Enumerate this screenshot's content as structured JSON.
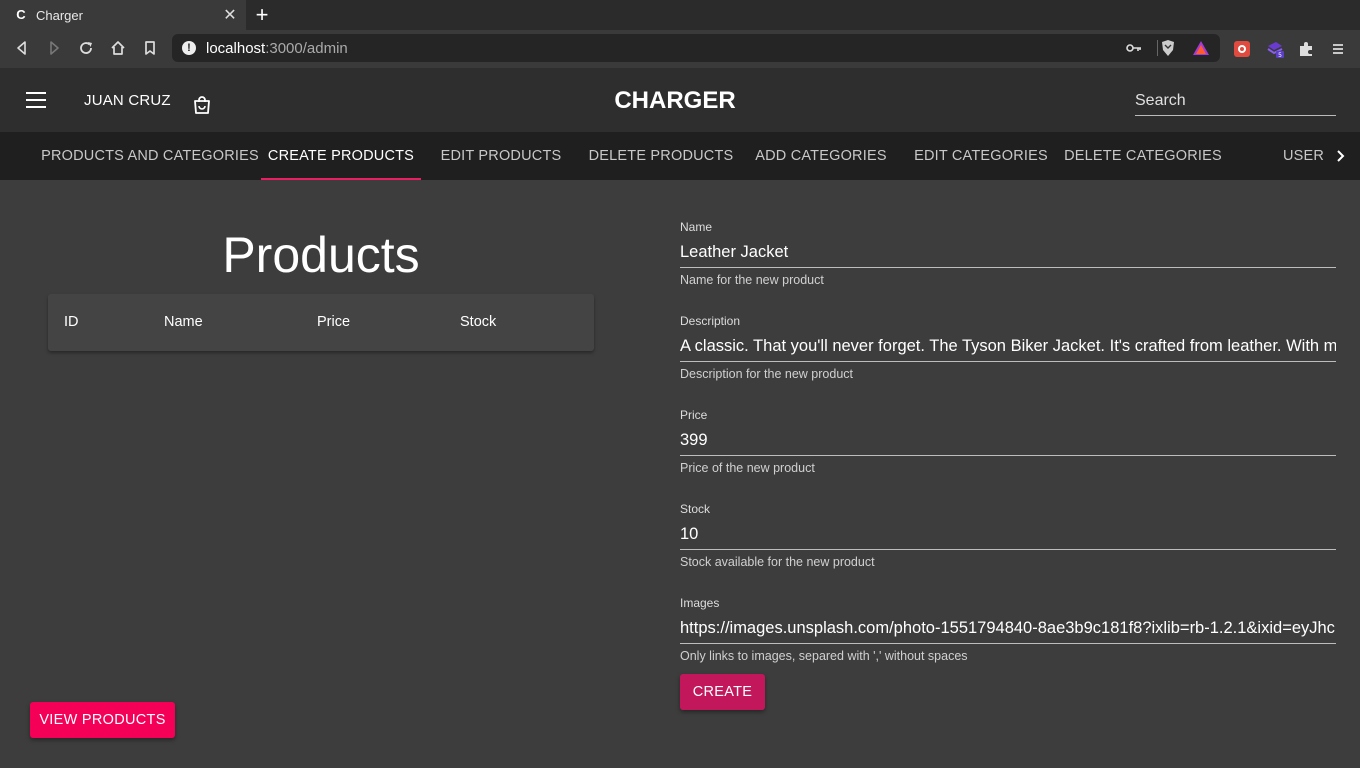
{
  "browser": {
    "tab_favicon": "C",
    "tab_title": "Charger",
    "url_host": "localhost",
    "url_path": ":3000/admin"
  },
  "header": {
    "user_name": "JUAN CRUZ",
    "brand": "CHARGER",
    "search_placeholder": "Search"
  },
  "nav": {
    "tabs": [
      {
        "label": "PRODUCTS AND CATEGORIES"
      },
      {
        "label": "CREATE PRODUCTS"
      },
      {
        "label": "EDIT PRODUCTS"
      },
      {
        "label": "DELETE PRODUCTS"
      },
      {
        "label": "ADD CATEGORIES"
      },
      {
        "label": "EDIT CATEGORIES"
      },
      {
        "label": "DELETE CATEGORIES"
      },
      {
        "label": "USER"
      }
    ],
    "active_tab": "CREATE PRODUCTS"
  },
  "products_panel": {
    "title": "Products",
    "columns": [
      "ID",
      "Name",
      "Price",
      "Stock"
    ],
    "view_button": "VIEW PRODUCTS"
  },
  "form": {
    "name": {
      "label": "Name",
      "value": "Leather Jacket",
      "help": "Name for the new product"
    },
    "description": {
      "label": "Description",
      "value": "A classic. That you'll never forget. The Tyson Biker Jacket. It's crafted from leather. With me",
      "help": "Description for the new product"
    },
    "price": {
      "label": "Price",
      "value": "399",
      "help": "Price of the new product"
    },
    "stock": {
      "label": "Stock",
      "value": "10",
      "help": "Stock available for the new product"
    },
    "images": {
      "label": "Images",
      "value": "https://images.unsplash.com/photo-1551794840-8ae3b9c181f8?ixlib=rb-1.2.1&ixid=eyJhc",
      "help": "Only links to images, separed with ',' without spaces"
    },
    "create_button": "CREATE"
  },
  "colors": {
    "accent": "#e91e63",
    "view_button": "#f50057",
    "create_button": "#c2185b",
    "background": "#3d3d3d"
  }
}
